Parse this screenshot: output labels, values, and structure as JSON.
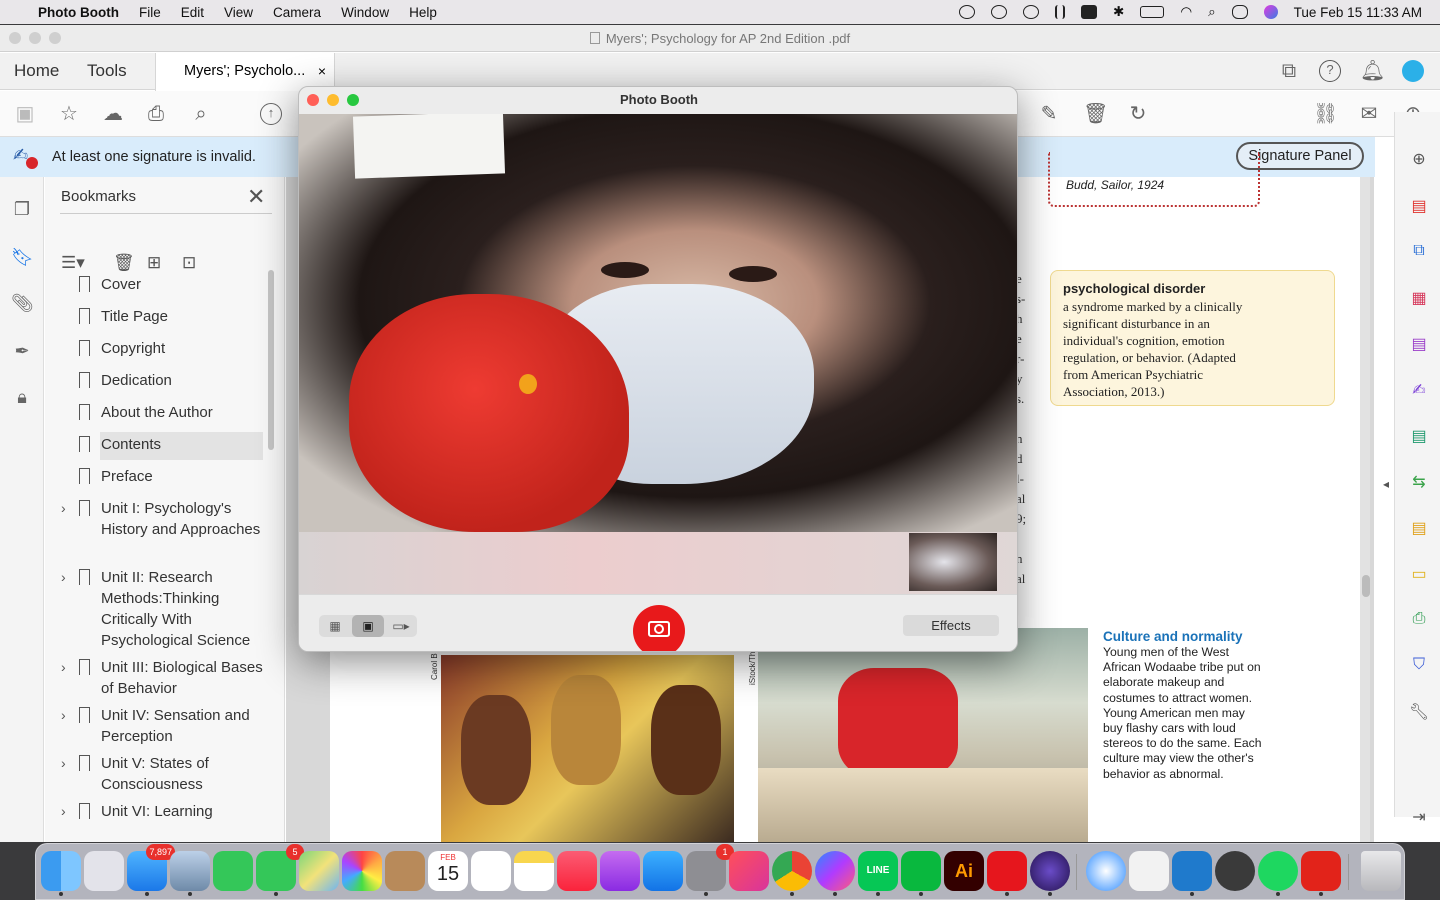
{
  "menubar": {
    "apple": "",
    "app_name": "Photo Booth",
    "menus": [
      "File",
      "Edit",
      "View",
      "Camera",
      "Window",
      "Help"
    ],
    "clock": "Tue Feb 15  11:33 AM"
  },
  "acrobat": {
    "window_title": "Myers'; Psychology for AP  2nd Edition  .pdf",
    "tabs": {
      "home": "Home",
      "tools": "Tools",
      "doc": "Myers'; Psycholo...",
      "doc_close": "×"
    },
    "signature_bar": {
      "message": "At least one signature is invalid.",
      "button": "Signature Panel"
    },
    "bookmarks": {
      "title": "Bookmarks",
      "close": "✕",
      "items": [
        {
          "label": "Cover",
          "expandable": false
        },
        {
          "label": "Title Page",
          "expandable": false
        },
        {
          "label": "Copyright",
          "expandable": false
        },
        {
          "label": "Dedication",
          "expandable": false
        },
        {
          "label": "About the Author",
          "expandable": false
        },
        {
          "label": "Contents",
          "expandable": false,
          "selected": true
        },
        {
          "label": "Preface",
          "expandable": false
        },
        {
          "label": "Unit I: Psychology's History and Approaches",
          "expandable": true
        },
        {
          "label": "Unit II: Research Methods:Thinking Critically With Psychological Science",
          "expandable": true
        },
        {
          "label": "Unit III: Biological Bases of Behavior",
          "expandable": true
        },
        {
          "label": "Unit IV: Sensation and Perception",
          "expandable": true
        },
        {
          "label": "Unit V: States of Consciousness",
          "expandable": true
        },
        {
          "label": "Unit VI: Learning",
          "expandable": true
        }
      ]
    },
    "page": {
      "quote_cite": "Budd, Sailor, 1924",
      "gloss_term": "psychological disorder",
      "gloss_def": "a syndrome marked by a clinically significant disturbance in an individual's cognition, emotion regulation, or behavior. (Adapted from American Psychiatric Association, 2013.)",
      "culture_title": "Culture and normality",
      "culture_body": "Young men of the West African Wodaabe tribe put on elaborate makeup and costumes to attract women. Young American men may buy flashy cars with loud stereos to do the same. Each culture may view the other's behavior as abnormal.",
      "photo_credit_1": "Carol B",
      "photo_credit_2": "iStock/Thi",
      "column_fragments": [
        "e",
        "s-",
        "h",
        "e",
        "r-",
        "y",
        "s.",
        "n",
        "d",
        "l-",
        "al",
        "9;",
        "n",
        "al"
      ]
    }
  },
  "photobooth": {
    "title": "Photo Booth",
    "effects_label": "Effects",
    "modes": [
      "grid-icon",
      "single-photo-icon",
      "video-icon"
    ],
    "selected_mode": "single-photo-icon"
  },
  "dock": {
    "badges": {
      "mail": "7,897",
      "messages": "5",
      "settings": "1"
    },
    "calendar": {
      "month": "FEB",
      "day": "15"
    },
    "labels": {
      "line": "LINE",
      "illustrator": "Ai"
    }
  },
  "colors": {
    "accent": "#1a72b8",
    "sig_bar": "#d9ecfb",
    "shutter": "#e8191b",
    "gloss_bg": "#fdf5dd"
  }
}
